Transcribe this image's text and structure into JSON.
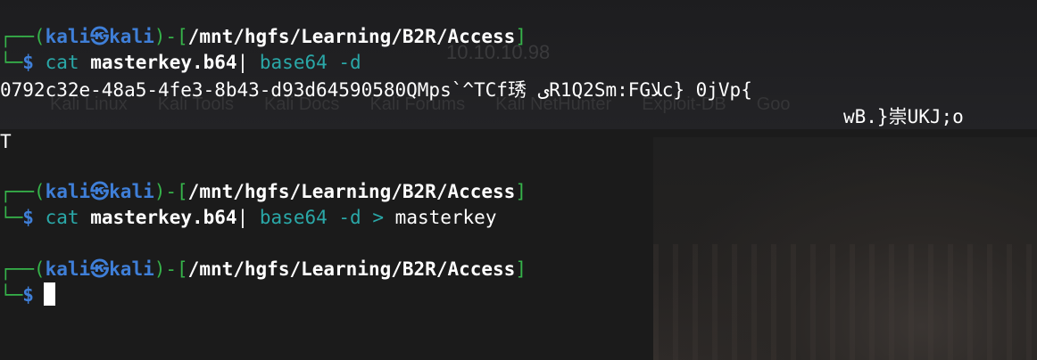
{
  "background": {
    "ghost_url": "10.10.10.98",
    "ghost_bookmarks": [
      "Kali Linux",
      "Kali Tools",
      "Kali Docs",
      "Kali Forums",
      "Kali NetHunter",
      "Exploit-DB",
      "Goo"
    ]
  },
  "prompt": {
    "user": "kali",
    "host": "kali",
    "path": "/mnt/hgfs/Learning/B2R/Access",
    "symbol": "$"
  },
  "blocks": [
    {
      "command": "cat",
      "argument": "masterkey.b64",
      "pipe": "|",
      "command2": "base64",
      "flag": "-d",
      "redirect": "",
      "target": "",
      "output": [
        "0792c32e-48a5-4fe3-8b43-d93d64590580QMps`^TCf琇 ىR1Q2Sm:FGﻼc} 0jVp{",
        "wB.}崇UKJ;o",
        "T"
      ]
    },
    {
      "command": "cat",
      "argument": "masterkey.b64",
      "pipe": "|",
      "command2": "base64",
      "flag": "-d",
      "redirect": ">",
      "target": "masterkey",
      "output": []
    }
  ],
  "colors": {
    "frame": "#36b34a",
    "user": "#3f7fd8",
    "command": "#2aa8a8",
    "background": "#1b1b1b"
  }
}
